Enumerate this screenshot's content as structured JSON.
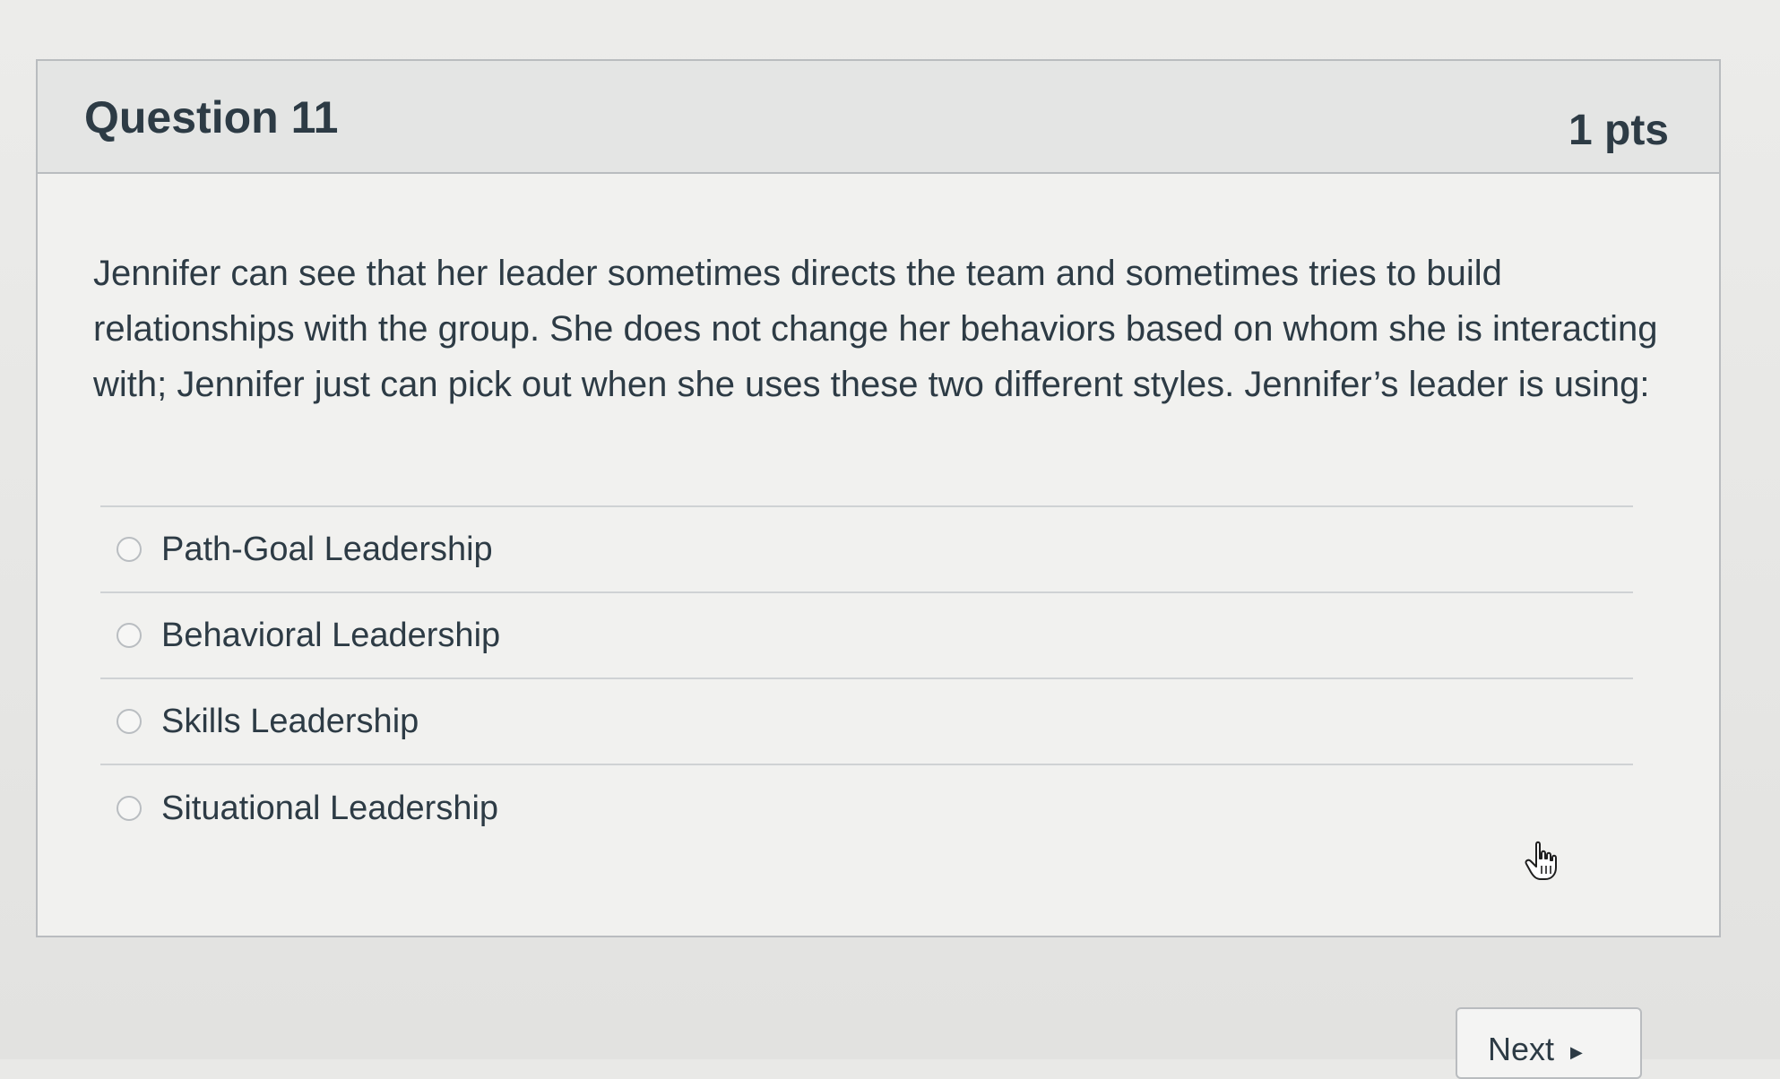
{
  "question": {
    "title": "Question 11",
    "points": "1 pts",
    "text": "Jennifer can see that her leader sometimes directs the team and sometimes tries to build relationships with the group. She does not change her behaviors based on whom she is interacting with; Jennifer just can pick out when she uses these two different styles. Jennifer’s leader is using:"
  },
  "answers": [
    {
      "label": "Path-Goal Leadership",
      "selected": false
    },
    {
      "label": "Behavioral Leadership",
      "selected": false
    },
    {
      "label": "Skills Leadership",
      "selected": false
    },
    {
      "label": "Situational Leadership",
      "selected": false
    }
  ],
  "navigation": {
    "next_label": "Next",
    "next_icon": "play-arrow-icon"
  },
  "cursor": {
    "icon": "hand-pointer-icon"
  }
}
